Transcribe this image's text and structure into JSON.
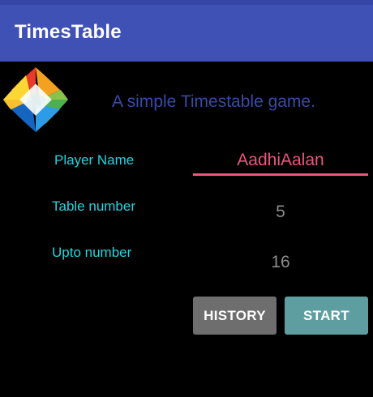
{
  "app": {
    "title": "TimesTable",
    "tagline": "A simple Timestable game."
  },
  "form": {
    "player_name_label": "Player Name",
    "player_name_value": "AadhiAalan",
    "table_number_label": "Table number",
    "table_number_value": "5",
    "upto_number_label": "Upto number",
    "upto_number_value": "16"
  },
  "actions": {
    "history_label": "HISTORY",
    "start_label": "START"
  },
  "colors": {
    "app_bar": "#3f51b5",
    "background": "#000000",
    "label": "#26d3df",
    "accent": "#e8577d",
    "history_button": "#6e6e6e",
    "start_button": "#5f9ea0"
  },
  "icons": {
    "logo": "pinwheel-logo-icon"
  }
}
